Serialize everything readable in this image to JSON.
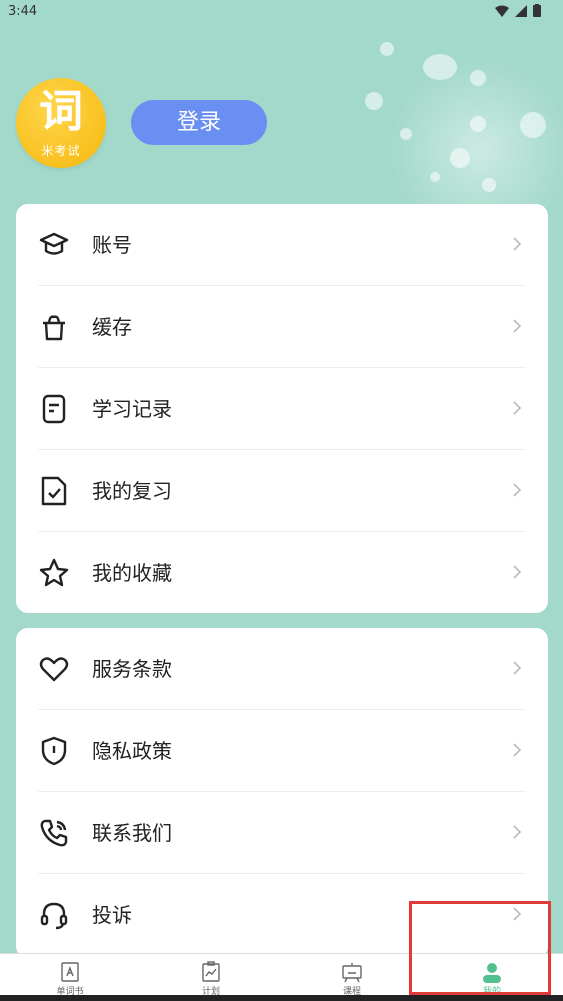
{
  "status": {
    "time": "3:44"
  },
  "header": {
    "logo_char": "词",
    "logo_sub": "米考试",
    "login_label": "登录"
  },
  "menu_group_1": [
    {
      "label": "账号",
      "icon": "graduation-cap-icon"
    },
    {
      "label": "缓存",
      "icon": "trash-bin-icon"
    },
    {
      "label": "学习记录",
      "icon": "document-icon"
    },
    {
      "label": "我的复习",
      "icon": "file-check-icon"
    },
    {
      "label": "我的收藏",
      "icon": "star-icon"
    }
  ],
  "menu_group_2": [
    {
      "label": "服务条款",
      "icon": "heart-icon"
    },
    {
      "label": "隐私政策",
      "icon": "shield-icon"
    },
    {
      "label": "联系我们",
      "icon": "phone-icon"
    },
    {
      "label": "投诉",
      "icon": "headset-icon"
    }
  ],
  "tabs": [
    {
      "label": "单词书",
      "icon": "wordbook-icon",
      "active": false
    },
    {
      "label": "计划",
      "icon": "plan-icon",
      "active": false
    },
    {
      "label": "课程",
      "icon": "course-icon",
      "active": false
    },
    {
      "label": "我的",
      "icon": "profile-icon",
      "active": true
    }
  ],
  "colors": {
    "background": "#a3d9cb",
    "login_button": "#6a8ff3",
    "logo": "#f5b80b",
    "active_tab": "#53c08f",
    "highlight": "#e03b3b"
  }
}
